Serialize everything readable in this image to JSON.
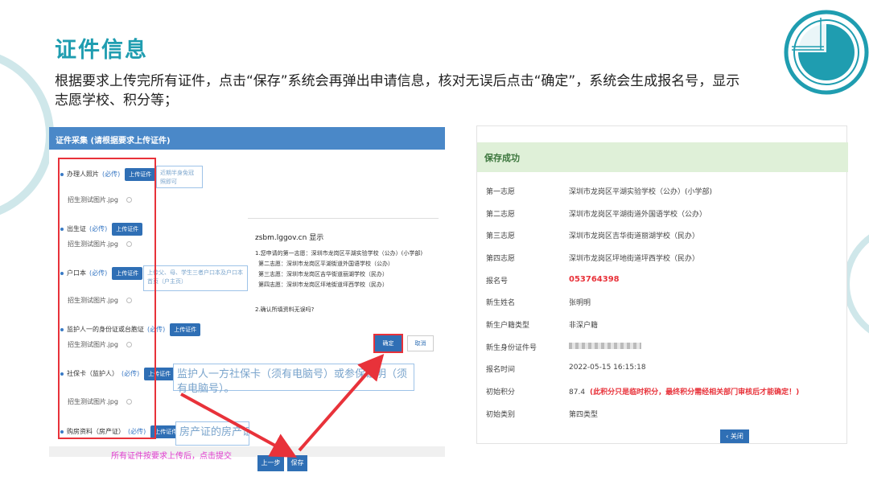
{
  "slide": {
    "title": "证件信息",
    "description": "根据要求上传完所有证件，点击“保存”系统会再弹出申请信息，核对无误后点击“确定”，系统会生成报名号，显示志愿学校、积分等；"
  },
  "left_form": {
    "header": "证件采集 (请根据要求上传证件)",
    "required_label": "(必传)",
    "upload_label": "上传证件",
    "pic_name": "招生测试图片.jpg",
    "fields": [
      {
        "label": "办理人照片"
      },
      {
        "label": "出生证"
      },
      {
        "label": "户口本"
      },
      {
        "label": "监护人一的身份证或台胞证"
      },
      {
        "label": "社保卡（监护人）"
      },
      {
        "label": "购房资料（房产证）"
      }
    ],
    "hints": {
      "photo": "近期半身免冠照即可",
      "hukou": "上传父、母、学生三者户口本及户口本首页（户主页）",
      "social": "监护人一方社保卡（须有电脑号）或参保证明（须有电脑号）。",
      "house": "房产证的房产证页"
    },
    "note": "所有证件按要求上传后，点击提交",
    "prev_button": "上一步",
    "save_button": "保存"
  },
  "dialog": {
    "title": "zsbm.lggov.cn 显示",
    "lines": [
      "1.您申请的第一志愿：深圳市龙岗区平湖实验学校（公办）(小学部)",
      "第二志愿：深圳市龙岗区平湖街道外国语学校（公办）",
      "第三志愿：深圳市龙岗区吉华街道丽湖学校（民办）",
      "第四志愿：深圳市龙岗区坪地街道坪西学校（民办）"
    ],
    "question": "2.确认所填资料无误吗?",
    "ok": "确定",
    "cancel": "取消"
  },
  "result": {
    "status": "保存成功",
    "rows": [
      {
        "label": "第一志愿",
        "value": "深圳市龙岗区平湖实验学校（公办）(小学部)"
      },
      {
        "label": "第二志愿",
        "value": "深圳市龙岗区平湖街道外国语学校（公办）"
      },
      {
        "label": "第三志愿",
        "value": "深圳市龙岗区吉华街道丽湖学校（民办）"
      },
      {
        "label": "第四志愿",
        "value": "深圳市龙岗区坪地街道坪西学校（民办）"
      },
      {
        "label": "报名号",
        "value": "053764398"
      },
      {
        "label": "新生姓名",
        "value": "张明明"
      },
      {
        "label": "新生户籍类型",
        "value": "非深户籍"
      },
      {
        "label": "新生身份证件号",
        "value": ""
      },
      {
        "label": "报名时间",
        "value": "2022-05-15 16:15:18"
      },
      {
        "label": "初始积分",
        "value": "87.4",
        "note": "(此积分只是临时积分，最终积分需经相关部门审核后才能确定！)"
      },
      {
        "label": "初始类别",
        "value": "第四类型"
      }
    ],
    "close_button": "关闭"
  },
  "colors": {
    "title": "#1f9db0",
    "accent": "#2f6fb5",
    "highlight": "#e8323a",
    "success_bg": "#dff0d8"
  }
}
